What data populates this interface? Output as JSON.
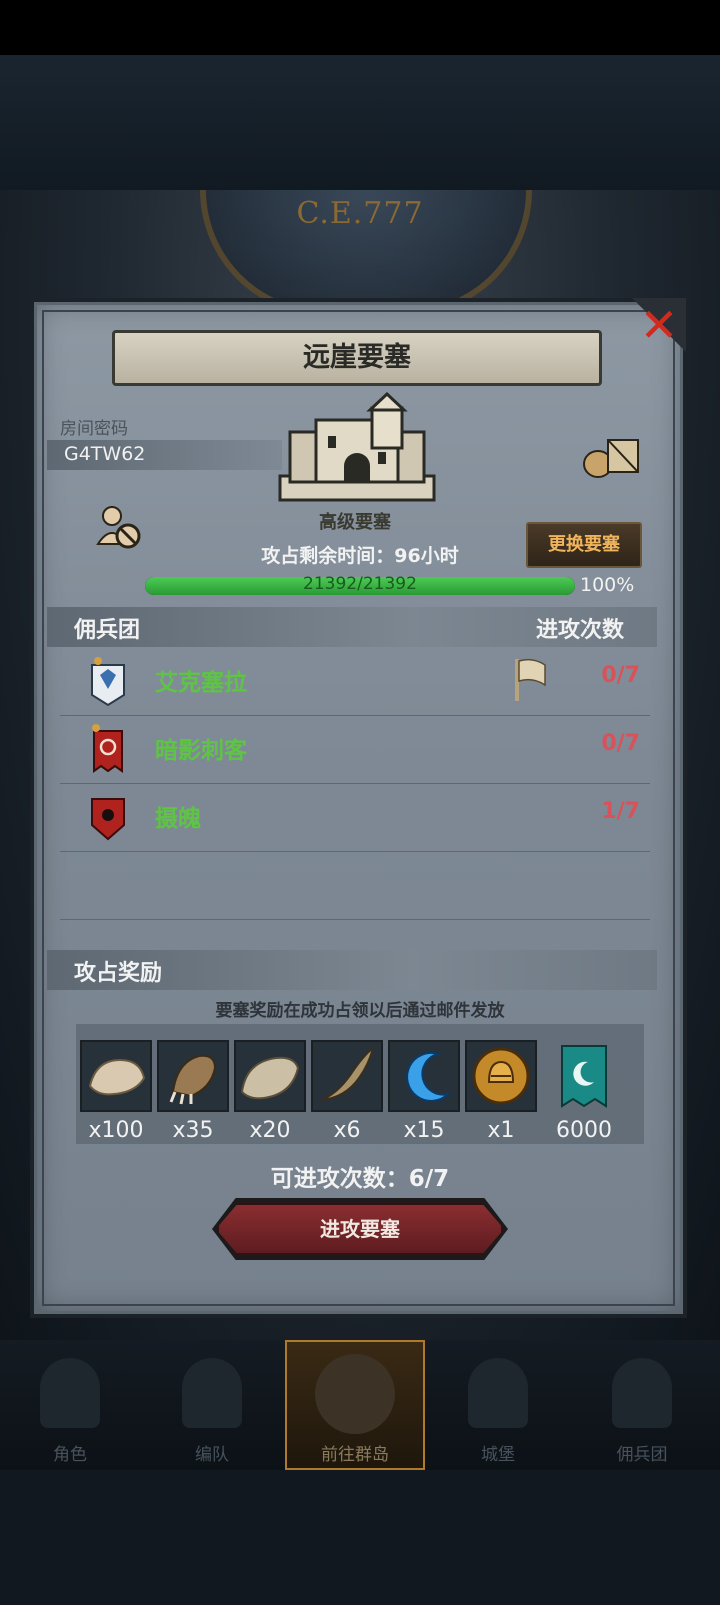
{
  "background": {
    "era_label": "C.E.777"
  },
  "modal": {
    "title": "远崖要塞",
    "room": {
      "label": "房间密码",
      "code": "G4TW62"
    },
    "fortress_grade": "高级要塞",
    "change_button": "更换要塞",
    "time_remaining": "攻占剩余时间：96小时",
    "progress": {
      "current": 21392,
      "max": 21392,
      "text": "21392/21392",
      "percent_text": "100%",
      "fraction": 1.0
    },
    "mercenary_section": {
      "title": "佣兵团",
      "attack_count_header": "进攻次数",
      "rows": [
        {
          "name": "艾克塞拉",
          "count": "0/7",
          "banner_color": "#e8edf2",
          "emblem_color": "#3a6fb0",
          "has_flag": true
        },
        {
          "name": "暗影刺客",
          "count": "0/7",
          "banner_color": "#b0221e",
          "emblem_color": "#f0e0d0",
          "has_flag": false
        },
        {
          "name": "摄魄",
          "count": "1/7",
          "banner_color": "#b0221e",
          "emblem_color": "#1a0d0d",
          "has_flag": false
        }
      ]
    },
    "reward_section": {
      "title": "攻占奖励",
      "note": "要塞奖励在成功占领以后通过邮件发放",
      "items": [
        {
          "icon": "fur-pelt-icon",
          "qty": "x100",
          "color": "#d8c9b0"
        },
        {
          "icon": "beast-claw-icon",
          "qty": "x35",
          "color": "#9a7a52"
        },
        {
          "icon": "beast-hide-icon",
          "qty": "x20",
          "color": "#cbbfa5"
        },
        {
          "icon": "horn-icon",
          "qty": "x6",
          "color": "#a8926a"
        },
        {
          "icon": "blue-crescent-icon",
          "qty": "x15",
          "color": "#3aa0e8"
        },
        {
          "icon": "golden-helmet-medal-icon",
          "qty": "x1",
          "color": "#c48a2a"
        },
        {
          "icon": "teal-banner-icon",
          "qty": "6000",
          "color": "#1a8a86"
        }
      ]
    },
    "attempts_text": "可进攻次数：6/7",
    "attack_button": "进攻要塞"
  },
  "bottom_nav": [
    {
      "label": "角色",
      "active": false
    },
    {
      "label": "编队",
      "active": false
    },
    {
      "label": "前往群岛",
      "active": true
    },
    {
      "label": "城堡",
      "active": false
    },
    {
      "label": "佣兵团",
      "active": false
    }
  ]
}
